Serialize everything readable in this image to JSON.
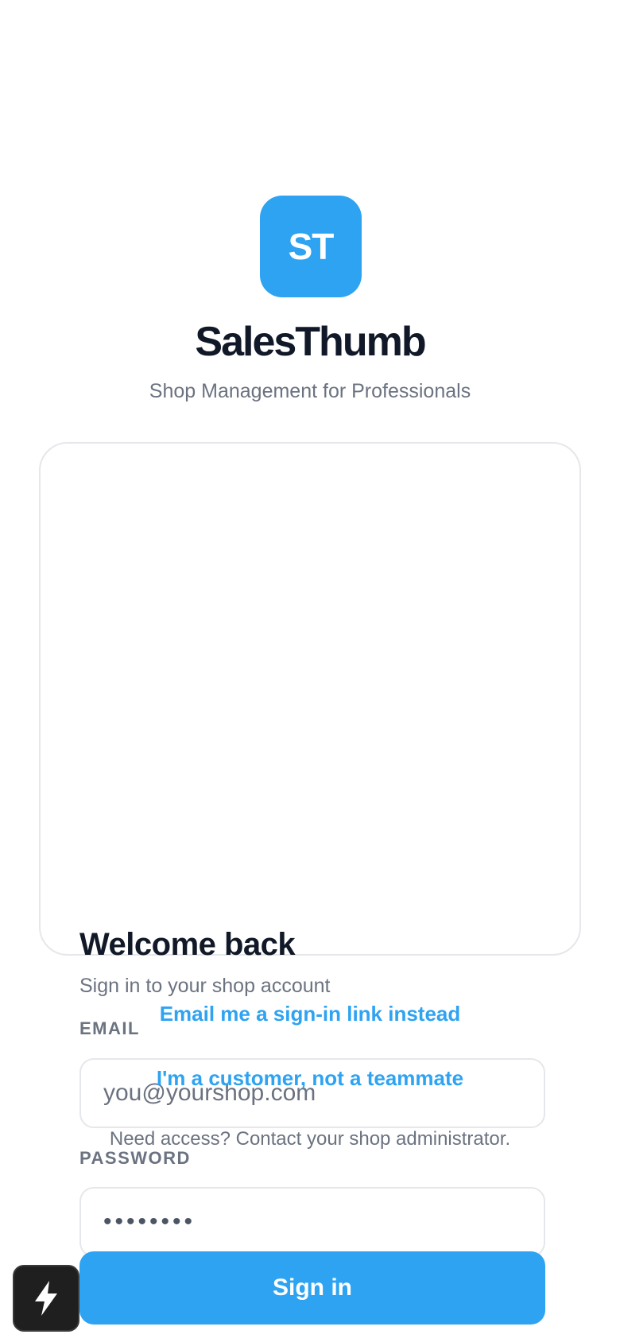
{
  "brand": {
    "logo_text": "ST",
    "name": "SalesThumb",
    "tagline": "Shop Management for Professionals",
    "accent_color": "#2ea3f2"
  },
  "card": {
    "title": "Welcome back",
    "subtitle": "Sign in to your shop account",
    "email": {
      "label": "EMAIL",
      "placeholder": "you@yourshop.com",
      "value": ""
    },
    "password": {
      "label": "PASSWORD",
      "value": "••••••••"
    },
    "signin_label": "Sign in"
  },
  "links": {
    "magic_link": "Email me a sign-in link instead",
    "customer": "I'm a customer, not a teammate"
  },
  "help_text": "Need access? Contact your shop administrator.",
  "dev_badge": {
    "icon": "lightning-bolt-icon"
  }
}
